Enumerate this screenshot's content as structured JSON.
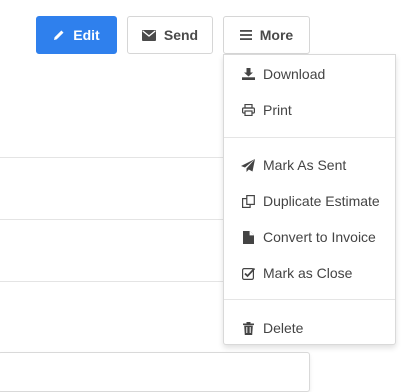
{
  "toolbar": {
    "edit_label": "Edit",
    "send_label": "Send",
    "more_label": "More"
  },
  "more_menu": {
    "items": [
      {
        "label": "Download",
        "icon": "download-icon"
      },
      {
        "label": "Print",
        "icon": "print-icon"
      },
      {
        "label": "Mark As Sent",
        "icon": "paper-plane-icon"
      },
      {
        "label": "Duplicate Estimate",
        "icon": "copy-icon"
      },
      {
        "label": "Convert to Invoice",
        "icon": "file-icon"
      },
      {
        "label": "Mark as Close",
        "icon": "check-square-icon"
      },
      {
        "label": "Delete",
        "icon": "trash-icon"
      }
    ]
  },
  "colors": {
    "primary": "#2f80ed",
    "text": "#444444",
    "border": "#d9d9d9"
  }
}
